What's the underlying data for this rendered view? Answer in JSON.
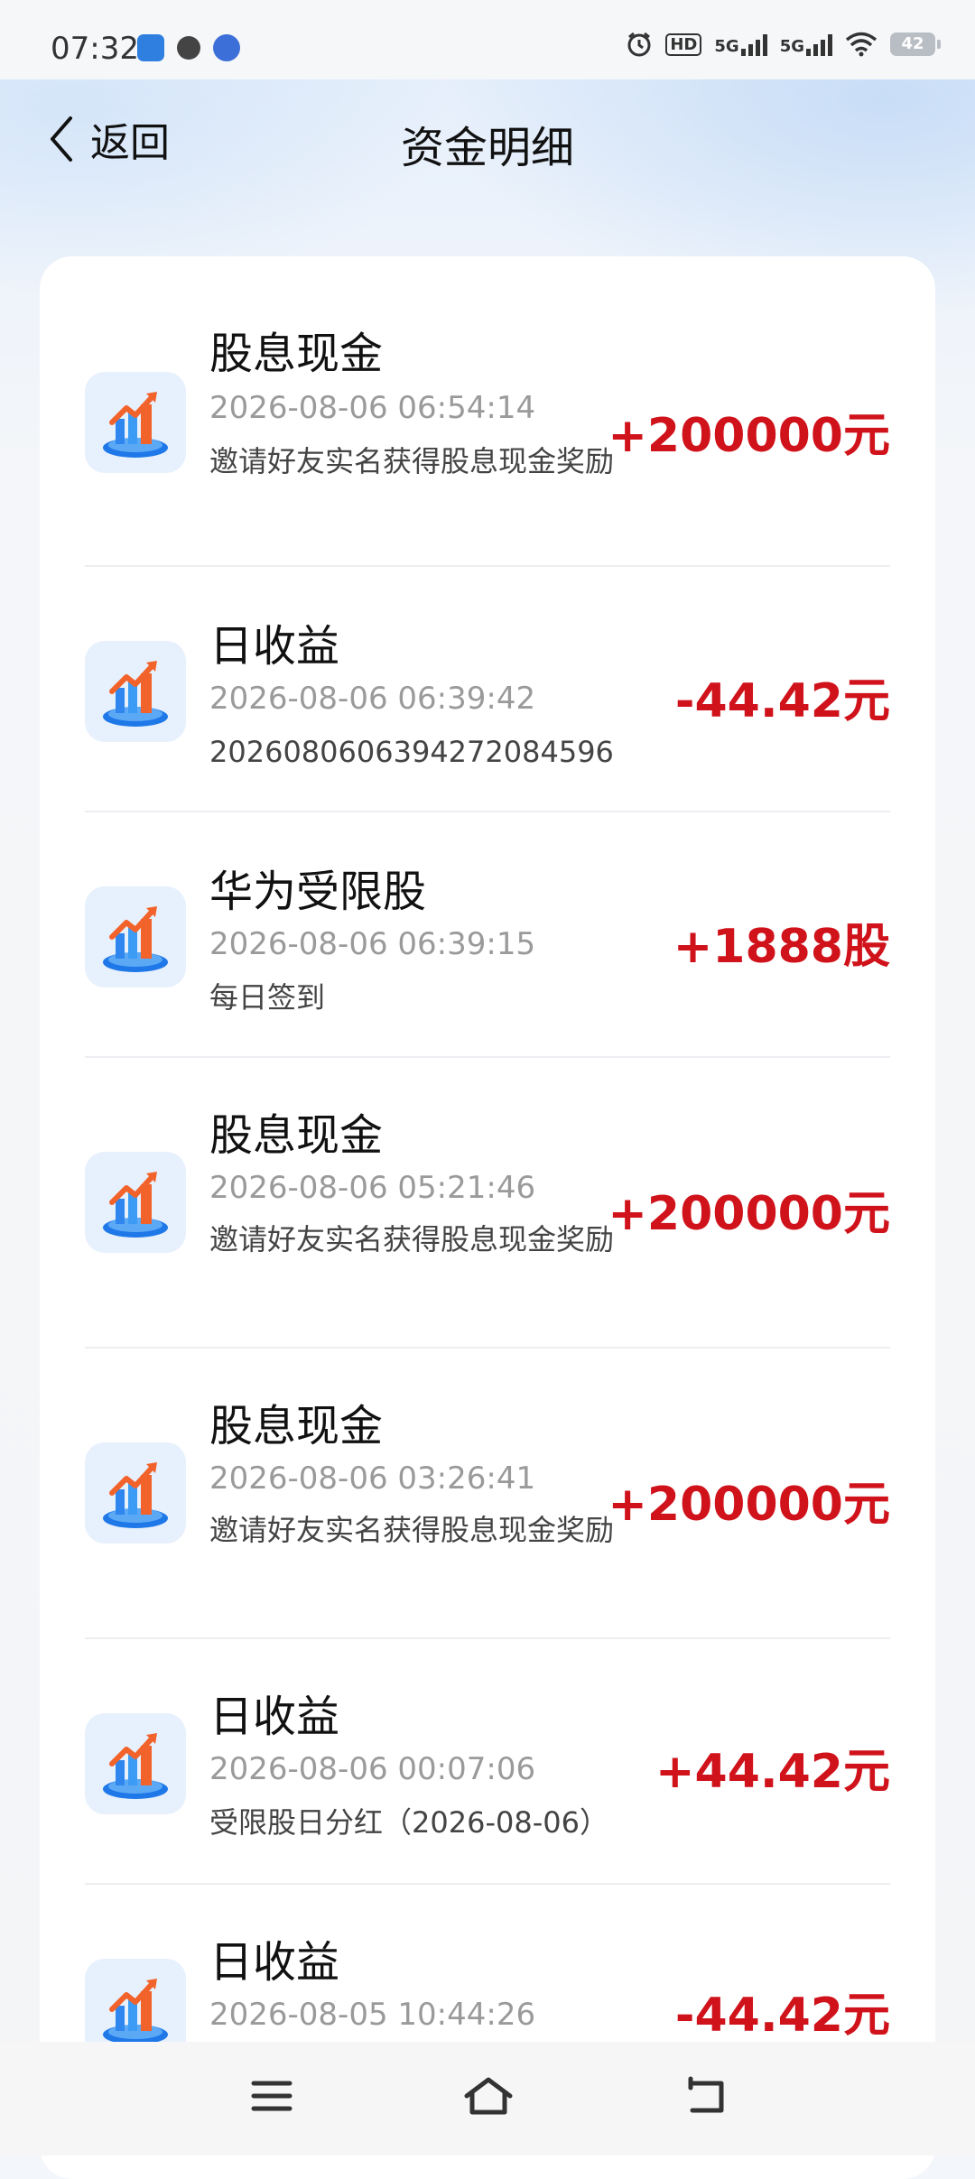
{
  "status_bar": {
    "time": "07:32",
    "hd_label": "HD",
    "net1": "5G",
    "net2": "5G",
    "battery": "42"
  },
  "header": {
    "back_label": "返回",
    "title": "资金明细"
  },
  "records": [
    {
      "title": "股息现金",
      "time": "2026-08-06 06:54:14",
      "desc": "邀请好友实名获得股息现金奖励",
      "amount": "+200000元"
    },
    {
      "title": "日收益",
      "time": "2026-08-06 06:39:42",
      "desc": "20260806063942720845​96",
      "amount": "-44.42元"
    },
    {
      "title": "华为受限股",
      "time": "2026-08-06 06:39:15",
      "desc": "每日签到",
      "amount": "+1888股"
    },
    {
      "title": "股息现金",
      "time": "2026-08-06 05:21:46",
      "desc": "邀请好友实名获得股息现金奖励",
      "amount": "+200000元"
    },
    {
      "title": "股息现金",
      "time": "2026-08-06 03:26:41",
      "desc": "邀请好友实名获得股息现金奖励",
      "amount": "+200000元"
    },
    {
      "title": "日收益",
      "time": "2026-08-06 00:07:06",
      "desc": "受限股日分红（2026-08-06）",
      "amount": "+44.42元"
    },
    {
      "title": "日收益",
      "time": "2026-08-05 10:44:26",
      "desc": "",
      "amount": "-44.42元"
    }
  ],
  "icons": {
    "record": "stock-chart-icon",
    "back": "chevron-left-icon",
    "nav_menu": "menu-icon",
    "nav_home": "home-icon",
    "nav_back": "back-icon"
  },
  "colors": {
    "amount": "#d0121b",
    "title": "#111111",
    "time": "#9a9a9a"
  }
}
